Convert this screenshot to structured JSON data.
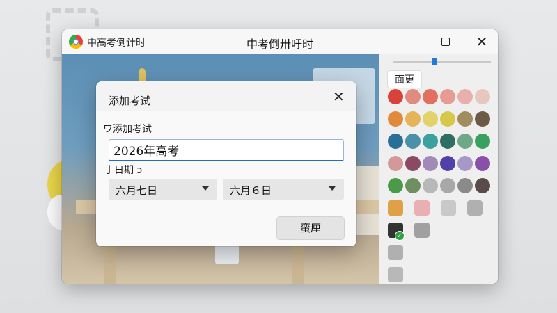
{
  "window": {
    "app_name": "中高考倒计时",
    "title": "中考倒卅吁时"
  },
  "side_panel": {
    "change_label": "面更",
    "selected_swatch_index": 13,
    "swatches": [
      "#d9423b",
      "#e08a80",
      "#e2705e",
      "#e89a94",
      "#e8b0aa",
      "#e7c7be",
      "#e08a3c",
      "#e3b45a",
      "#e2d26a",
      "#d8c84a",
      "#a08c5c",
      "#6b5a44",
      "#2a6f98",
      "#4a90a8",
      "#3aa0a0",
      "#2f6e62",
      "#6fa888",
      "#3aa060",
      "#d49898",
      "#8a4a66",
      "#a08ab8",
      "#5040a8",
      "#a898c8",
      "#8a50a8",
      "#4a9a48",
      "#6e9060",
      "#b8b8b8",
      "#a8a8a8",
      "#8a8a8a",
      "#5a4a4a",
      "#e0a048",
      "#e8b0b0",
      "#c8c8c8",
      "#b0b0b0",
      "#333333",
      "#a0a0a0",
      "#b0b0b0",
      "#b8b8b8"
    ]
  },
  "dialog": {
    "title": "添加考试",
    "name_label": "ワ添加考试",
    "name_value": "2026年高考",
    "date_label": "亅日期 ↄ",
    "month_value": "六月七日",
    "day_value": "六月６日",
    "save_label": "蛮厘"
  }
}
